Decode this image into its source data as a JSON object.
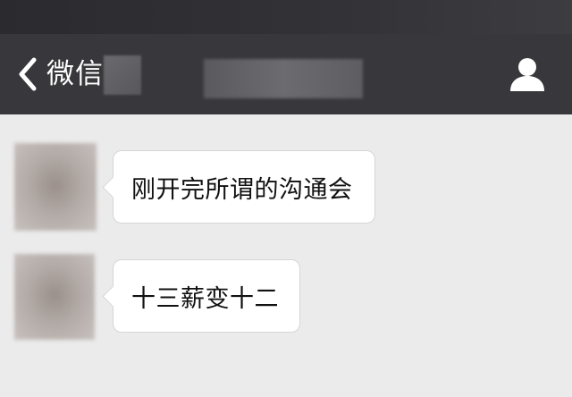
{
  "nav": {
    "back_label": "微信",
    "back_icon": "chevron-left-icon",
    "profile_icon": "person-icon"
  },
  "messages": [
    {
      "text": "刚开完所谓的沟通会"
    },
    {
      "text": "十三薪变十二"
    }
  ],
  "colors": {
    "status_bar": "#2e2e32",
    "nav_bar": "#38383c",
    "chat_background": "#ebebeb",
    "bubble": "#ffffff",
    "bubble_border": "#d6d6d6",
    "text": "#111111"
  }
}
